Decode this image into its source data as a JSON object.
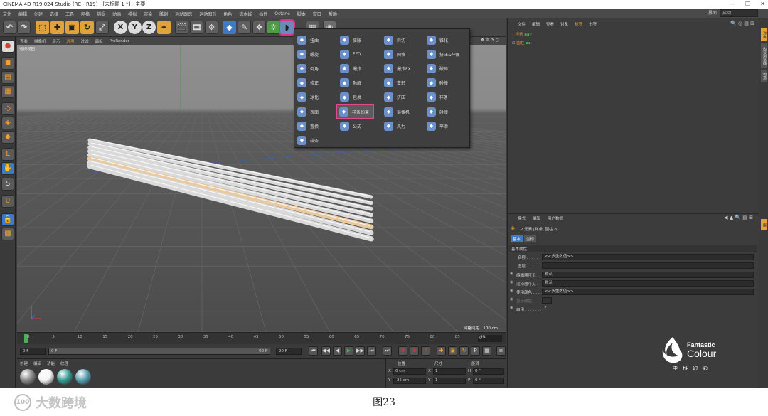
{
  "window": {
    "title": "CINEMA 4D R19.024 Studio (RC - R19) - [未标题 1 *] - 主要",
    "controls": [
      "—",
      "❐",
      "✕"
    ]
  },
  "menu": [
    "文件",
    "编辑",
    "创建",
    "选择",
    "工具",
    "网格",
    "捕捉",
    "动画",
    "模拟",
    "渲染",
    "雕刻",
    "运动跟踪",
    "运动图形",
    "角色",
    "流水线",
    "插件",
    "Octane",
    "脚本",
    "窗口",
    "帮助"
  ],
  "layout": {
    "label": "界面",
    "value": "启动"
  },
  "toolbar": {
    "x_label": "X",
    "y_label": "Y",
    "z_label": "Z"
  },
  "viewport": {
    "menu": [
      "查看",
      "摄像机",
      "显示",
      "选项",
      "过滤",
      "面板",
      "ProRender"
    ],
    "active_menu_index": 3,
    "camera_label": "透视视图",
    "status": "网格间距 : 100 cm",
    "nav_icons": "✥ ⇕ ⟳ ◻"
  },
  "popup": {
    "columns": [
      [
        {
          "label": "扭曲",
          "icon": "bend-deformer-icon"
        },
        {
          "label": "螺旋",
          "icon": "twist-deformer-icon"
        },
        {
          "label": "倒角",
          "icon": "bevel-deformer-icon"
        },
        {
          "label": "修正",
          "icon": "correction-deformer-icon"
        },
        {
          "label": "球化",
          "icon": "spherify-deformer-icon"
        },
        {
          "label": "表面",
          "icon": "surface-deformer-icon"
        },
        {
          "label": "置换",
          "icon": "displacer-deformer-icon"
        },
        {
          "label": "样条",
          "icon": "spline-deformer-icon"
        }
      ],
      [
        {
          "label": "膨胀",
          "icon": "bulge-deformer-icon"
        },
        {
          "label": "FFD",
          "icon": "ffd-deformer-icon"
        },
        {
          "label": "爆炸",
          "icon": "explosion-deformer-icon"
        },
        {
          "label": "融解",
          "icon": "melt-deformer-icon"
        },
        {
          "label": "包裹",
          "icon": "wrap-deformer-icon"
        },
        {
          "label": "样条约束",
          "icon": "spline-wrap-icon"
        },
        {
          "label": "公式",
          "icon": "formula-deformer-icon"
        }
      ],
      [
        {
          "label": "斜切",
          "icon": "shear-deformer-icon"
        },
        {
          "label": "网格",
          "icon": "mesh-deformer-icon"
        },
        {
          "label": "爆炸FX",
          "icon": "explosion-fx-icon"
        },
        {
          "label": "变形",
          "icon": "morph-deformer-icon"
        },
        {
          "label": "挤压",
          "icon": "squash-deformer-icon"
        },
        {
          "label": "摄像机",
          "icon": "camera-deformer-icon"
        },
        {
          "label": "风力",
          "icon": "wind-deformer-icon"
        }
      ],
      [
        {
          "label": "锥化",
          "icon": "taper-deformer-icon"
        },
        {
          "label": "挤压&伸展",
          "icon": "squash-stretch-icon"
        },
        {
          "label": "破碎",
          "icon": "shatter-deformer-icon"
        },
        {
          "label": "碰撞",
          "icon": "collision-deformer-icon"
        },
        {
          "label": "样条",
          "icon": "spline-rail-icon"
        },
        {
          "label": "碰撞",
          "icon": "collision2-deformer-icon"
        },
        {
          "label": "平滑",
          "icon": "smoothing-deformer-icon"
        }
      ]
    ],
    "highlight_index": 5
  },
  "timeline": {
    "ticks": [
      "0",
      "5",
      "10",
      "15",
      "20",
      "25",
      "30",
      "35",
      "40",
      "45",
      "50",
      "55",
      "60",
      "65",
      "70",
      "75",
      "80",
      "85",
      "90"
    ],
    "current_frame": "0 F"
  },
  "playback": {
    "start": "0 F",
    "start2": "0 F",
    "end": "90 F",
    "end2": "90 F"
  },
  "materials": {
    "tabs": [
      "创建",
      "编辑",
      "功能",
      "纹理"
    ],
    "balls": [
      "#8a8a8a",
      "#f4f4f4",
      "#3a9c95",
      "#5a9fb0"
    ]
  },
  "coords": {
    "headers": [
      "位置",
      "尺寸",
      "旋转"
    ],
    "rows": [
      [
        "X",
        "0 cm",
        "X",
        "1",
        "H",
        "0 °"
      ],
      [
        "Y",
        "-25 cm",
        "Y",
        "1",
        "P",
        "0 °"
      ]
    ]
  },
  "object_manager": {
    "menu": [
      "文件",
      "编辑",
      "查看",
      "对象",
      "标签",
      "书签"
    ],
    "objects": [
      {
        "name": "样条"
      },
      {
        "name": "圆柱"
      }
    ]
  },
  "attributes": {
    "menu": [
      "模式",
      "编辑",
      "用户数据"
    ],
    "object_title": "2 元素 [样条, 圆柱 B]",
    "tabs": [
      "基本",
      "坐标"
    ],
    "section": "基本属性",
    "fields": [
      {
        "label": "名称 . . . . . . .",
        "value": "<<多重数值>>"
      },
      {
        "label": "图层 . . . . . . .",
        "value": ""
      },
      {
        "label": "编辑器可见 . . .",
        "value": "默认"
      },
      {
        "label": "渲染器可见 . . .",
        "value": "默认"
      },
      {
        "label": "使用颜色 . . . . .",
        "value": "<<多重数值>>"
      },
      {
        "label": "显示颜色 . . . . .",
        "value": ""
      },
      {
        "label": "启用 . . . . . . .",
        "value": "✓"
      }
    ]
  },
  "side_tabs": [
    "对象",
    "内容浏览器",
    "构造",
    "层"
  ],
  "logo": {
    "line1": "Fantastic",
    "line2": "Colour",
    "line3": "中科幻彩"
  },
  "caption": "图23",
  "watermark": {
    "icon_text": "100",
    "text": "大数跨境"
  },
  "colors": {
    "accent_orange": "#e0a23a",
    "highlight_pink": "#e24a8f",
    "ui_dark": "#3c3c3c"
  }
}
